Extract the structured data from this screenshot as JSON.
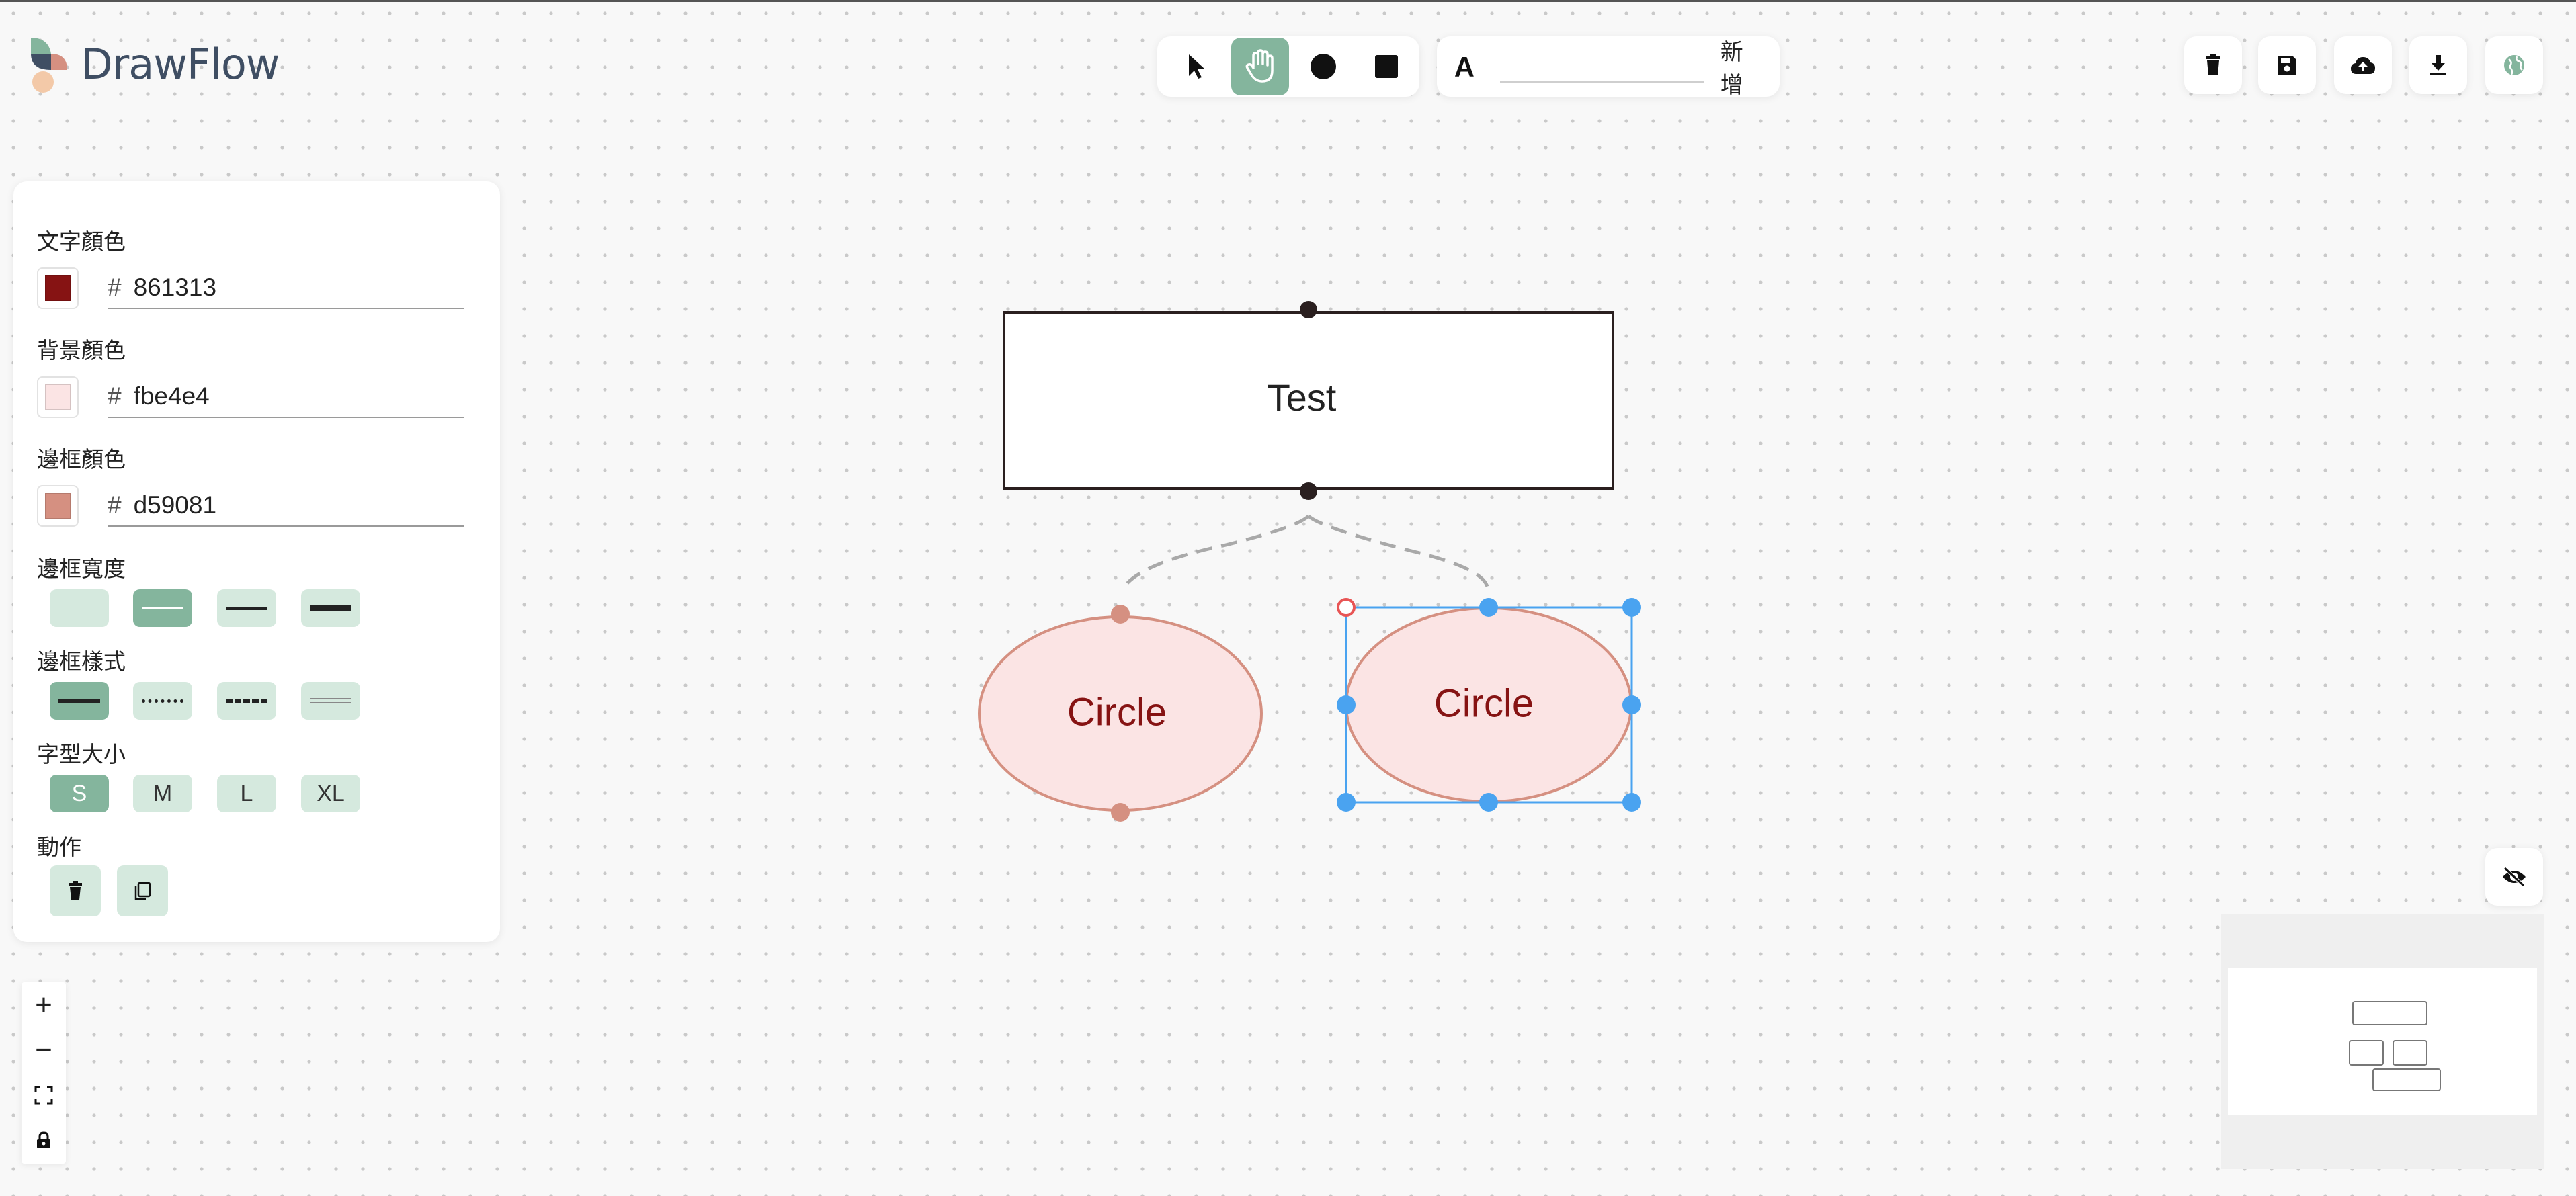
{
  "app": {
    "name": "DrawFlow"
  },
  "toolbar": {
    "tools": [
      "select-pointer",
      "hand-pan",
      "circle-shape",
      "square-shape"
    ],
    "active_tool": "hand-pan",
    "text_tool_icon": "text-A-icon",
    "text_input_value": "",
    "text_input_placeholder": "",
    "add_label": "新增"
  },
  "top_right_buttons": [
    "trash-icon",
    "save-icon",
    "cloud-upload-icon",
    "download-icon",
    "globe-icon"
  ],
  "panel": {
    "text_color_label": "文字顏色",
    "text_color_value": "861313",
    "bg_color_label": "背景顏色",
    "bg_color_value": "fbe4e4",
    "border_color_label": "邊框顏色",
    "border_color_value": "d59081",
    "hash": "#",
    "border_width_label": "邊框寬度",
    "border_style_label": "邊框樣式",
    "font_size_label": "字型大小",
    "font_sizes": [
      "S",
      "M",
      "L",
      "XL"
    ],
    "selected_font_size": "S",
    "actions_label": "動作"
  },
  "colors": {
    "accent": "#84b59d",
    "accent_light": "#d5e9de",
    "text_color": "#861313",
    "bg_color": "#fbe4e4",
    "border_color": "#d59081",
    "selection": "#4aa3f0"
  },
  "canvas": {
    "nodes": [
      {
        "type": "rectangle",
        "text": "Test"
      },
      {
        "type": "circle",
        "text": "Circle"
      },
      {
        "type": "circle",
        "text": "Circle",
        "selected": true
      }
    ]
  },
  "zoom_controls": {
    "zoom_in": "+",
    "zoom_out": "−"
  }
}
